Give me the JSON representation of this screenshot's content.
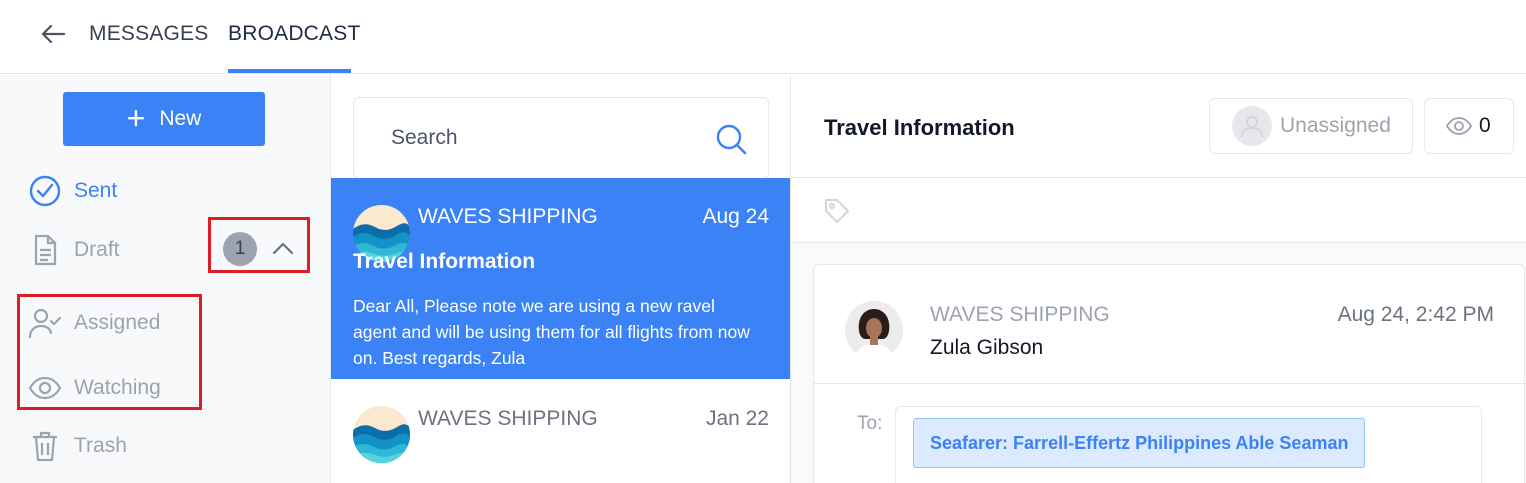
{
  "header": {
    "tabs": [
      {
        "label": "MESSAGES"
      },
      {
        "label": "BROADCAST",
        "active": true
      }
    ]
  },
  "sidebar": {
    "new_label": "New",
    "items": [
      {
        "label": "Sent",
        "icon": "check-circle-icon",
        "active": true
      },
      {
        "label": "Draft",
        "icon": "document-icon",
        "badge": "1"
      },
      {
        "label": "Assigned",
        "icon": "user-check-icon"
      },
      {
        "label": "Watching",
        "icon": "eye-icon"
      },
      {
        "label": "Trash",
        "icon": "trash-icon"
      }
    ]
  },
  "search": {
    "placeholder": "Search"
  },
  "messages": [
    {
      "sender": "WAVES SHIPPING",
      "date": "Aug 24",
      "subject": "Travel Information",
      "preview": "Dear All, Please note we are using a new ravel agent and will be using them for all flights from now on. Best regards, Zula",
      "selected": true
    },
    {
      "sender": "WAVES SHIPPING",
      "date": "Jan 22"
    }
  ],
  "detail": {
    "title": "Travel Information",
    "assignee_label": "Unassigned",
    "watchers_count": "0",
    "message": {
      "company": "WAVES SHIPPING",
      "sender": "Zula Gibson",
      "datetime": "Aug 24, 2:42 PM",
      "to_label": "To:",
      "recipients": [
        "Seafarer: Farrell-Effertz Philippines Able Seaman"
      ]
    }
  },
  "colors": {
    "accent": "#3b82f6",
    "highlight_box": "#dc1f26",
    "muted": "#9ca3af"
  }
}
